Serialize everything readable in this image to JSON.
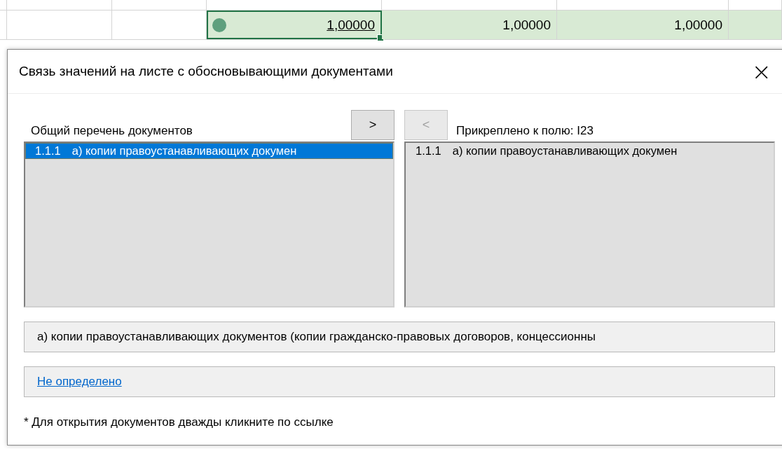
{
  "sheet": {
    "cells": [
      {
        "selected": false,
        "highlighted": false
      },
      {
        "selected": false,
        "highlighted": false
      },
      {
        "value": "1,00000",
        "selected": true,
        "highlighted": true
      },
      {
        "value": "1,00000",
        "selected": false,
        "highlighted": true
      },
      {
        "value": "1,00000",
        "selected": false,
        "highlighted": true
      },
      {
        "selected": false,
        "highlighted": true
      }
    ]
  },
  "dialog": {
    "title": "Связь значений на листе с обосновывающими документами",
    "close": "×",
    "all_documents": {
      "label": "Общий перечень документов",
      "items": [
        {
          "number": "1.1.1",
          "text": "а) копии правоустанавливающих докумен",
          "selected": true
        }
      ]
    },
    "add_button": {
      "label": ">",
      "disabled": false
    },
    "remove_button": {
      "label": "<",
      "disabled": true
    },
    "attached": {
      "label": "Прикреплено к полю: I23",
      "items": [
        {
          "number": "1.1.1",
          "text": "а) копии правоустанавливающих докумен",
          "selected": false
        }
      ]
    },
    "description": "а) копии правоустанавливающих документов (копии гражданско-правовых договоров, концессионны",
    "link": "Не определено",
    "footnote": "* Для открытия документов дважды кликните по ссылке"
  }
}
